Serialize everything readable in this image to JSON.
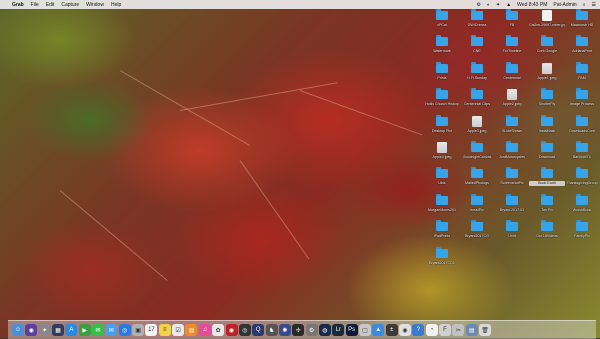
{
  "menubar": {
    "apple": "",
    "app": "Grab",
    "menus": [
      "File",
      "Edit",
      "Capture",
      "Window",
      "Help"
    ],
    "status_icons": [
      "⚙",
      "◐",
      "✦",
      "▲"
    ],
    "clock": "Wed 8:43 PM",
    "user": "Pat-Admin",
    "search": "⌕",
    "menu_list": "☰"
  },
  "desktop": {
    "icons": [
      {
        "label": "vPCal",
        "kind": "folder"
      },
      {
        "label": "GWICrimea",
        "kind": "folder"
      },
      {
        "label": "FB",
        "kind": "folder"
      },
      {
        "label": "CalJim-29697-mber.jpg",
        "kind": "file"
      },
      {
        "label": "Macintosh HD",
        "kind": "folder"
      },
      {
        "label": "Watermark",
        "kind": "folder"
      },
      {
        "label": "CNE",
        "kind": "folder"
      },
      {
        "label": "ForTimeline",
        "kind": "folder"
      },
      {
        "label": "Cont.Google",
        "kind": "folder"
      },
      {
        "label": "AdrianaPrint",
        "kind": "folder"
      },
      {
        "label": "Prints",
        "kind": "folder"
      },
      {
        "label": "H.Fl.Sunday",
        "kind": "folder"
      },
      {
        "label": "Centennial",
        "kind": "folder"
      },
      {
        "label": "Apple1.jpeg",
        "kind": "jpeg"
      },
      {
        "label": "PAM",
        "kind": "folder"
      },
      {
        "label": "Hollis Church History",
        "kind": "folder"
      },
      {
        "label": "Centennial Clips",
        "kind": "folder"
      },
      {
        "label": "Apple2.jpeg",
        "kind": "jpeg"
      },
      {
        "label": "ShutterFly",
        "kind": "folder"
      },
      {
        "label": "Image Process",
        "kind": "folder"
      },
      {
        "label": "Desktop Pict",
        "kind": "folder"
      },
      {
        "label": "Apple3.jpeg",
        "kind": "jpeg"
      },
      {
        "label": "SLideShows",
        "kind": "folder"
      },
      {
        "label": "InstaMask",
        "kind": "folder"
      },
      {
        "label": "DownloadsCont",
        "kind": "folder"
      },
      {
        "label": "Apple4.jpeg",
        "kind": "jpeg"
      },
      {
        "label": "GoodnightCanvas",
        "kind": "folder"
      },
      {
        "label": "JordMotorcycles",
        "kind": "folder"
      },
      {
        "label": "Download",
        "kind": "folder"
      },
      {
        "label": "BarMoMTX",
        "kind": "folder"
      },
      {
        "label": "Ubis",
        "kind": "folder"
      },
      {
        "label": "MailedPhotogs",
        "kind": "folder"
      },
      {
        "label": "ScreenshotPix",
        "kind": "folder"
      },
      {
        "label": "Book Earth",
        "kind": "folder",
        "selected": true
      },
      {
        "label": "ThanksgivingGroup",
        "kind": "folder"
      },
      {
        "label": "MorganMoms201",
        "kind": "folder"
      },
      {
        "label": "emailPix",
        "kind": "folder"
      },
      {
        "label": "Bryant.2017.03",
        "kind": "folder"
      },
      {
        "label": "Tax Pix",
        "kind": "folder"
      },
      {
        "label": "WorshBook",
        "kind": "folder"
      },
      {
        "label": "iPadPrints",
        "kind": "folder"
      },
      {
        "label": "Bryant2017CG",
        "kind": "folder"
      },
      {
        "label": "Unht",
        "kind": "folder"
      },
      {
        "label": "Oct.18Videos",
        "kind": "folder"
      },
      {
        "label": "FamilyPix",
        "kind": "folder"
      },
      {
        "label": "Bryant2017CG1",
        "kind": "folder"
      }
    ]
  },
  "dock": {
    "apps": [
      {
        "name": "finder",
        "color": "#4a90d9",
        "glyph": "☺"
      },
      {
        "name": "siri",
        "color": "#5a3fa0",
        "glyph": "◉"
      },
      {
        "name": "launchpad",
        "color": "#888888",
        "glyph": "✦"
      },
      {
        "name": "mission-control",
        "color": "#333a5a",
        "glyph": "▦"
      },
      {
        "name": "app-store",
        "color": "#2a8ae0",
        "glyph": "A"
      },
      {
        "name": "facetime",
        "color": "#3aa040",
        "glyph": "▶"
      },
      {
        "name": "messages",
        "color": "#35c04a",
        "glyph": "✉"
      },
      {
        "name": "mail",
        "color": "#4aa0e8",
        "glyph": "✉"
      },
      {
        "name": "safari",
        "color": "#2a7ae0",
        "glyph": "◎"
      },
      {
        "name": "preview",
        "color": "#b0b0b0",
        "glyph": "▣"
      },
      {
        "name": "calendar",
        "color": "#f5f5f5",
        "glyph": "17"
      },
      {
        "name": "notes",
        "color": "#f2d34a",
        "glyph": "≡"
      },
      {
        "name": "reminders",
        "color": "#e8e8e8",
        "glyph": "☑"
      },
      {
        "name": "books",
        "color": "#f08a2a",
        "glyph": "▤"
      },
      {
        "name": "itunes",
        "color": "#e84a9a",
        "glyph": "♫"
      },
      {
        "name": "photos",
        "color": "#e8e8e8",
        "glyph": "✿"
      },
      {
        "name": "photo-booth",
        "color": "#c0202a",
        "glyph": "◉"
      },
      {
        "name": "dvd-player",
        "color": "#333333",
        "glyph": "◎"
      },
      {
        "name": "quicktime",
        "color": "#2a3a6a",
        "glyph": "Q"
      },
      {
        "name": "chess",
        "color": "#555555",
        "glyph": "♞"
      },
      {
        "name": "image-capture",
        "color": "#3a4a8a",
        "glyph": "✺"
      },
      {
        "name": "compass",
        "color": "#2a2a2a",
        "glyph": "✢"
      },
      {
        "name": "system-preferences",
        "color": "#777777",
        "glyph": "⚙"
      },
      {
        "name": "pixelmator",
        "color": "#1a2a4a",
        "glyph": "◍"
      },
      {
        "name": "lightroom",
        "color": "#1b2a3a",
        "glyph": "Lr"
      },
      {
        "name": "photoshop",
        "color": "#0a1a3a",
        "glyph": "Ps"
      },
      {
        "name": "screenshot-tool",
        "color": "#c8c8c8",
        "glyph": "▢"
      },
      {
        "name": "keynote",
        "color": "#3a8ae0",
        "glyph": "▲"
      },
      {
        "name": "calculator",
        "color": "#3a3a3a",
        "glyph": "±"
      },
      {
        "name": "chrome",
        "color": "#e0e0e0",
        "glyph": "◉"
      },
      {
        "name": "utility",
        "color": "#3a7ad0",
        "glyph": "?"
      },
      {
        "name": "clock",
        "color": "#f2f2f2",
        "glyph": "◔"
      },
      {
        "name": "font-book",
        "color": "#d0d0d0",
        "glyph": "F"
      },
      {
        "name": "grab",
        "color": "#c0c0c0",
        "glyph": "✂"
      },
      {
        "name": "documents-stack",
        "color": "#6a8ab0",
        "glyph": "▤"
      },
      {
        "name": "trash",
        "color": "#d8d8d8",
        "glyph": "🗑"
      }
    ]
  }
}
